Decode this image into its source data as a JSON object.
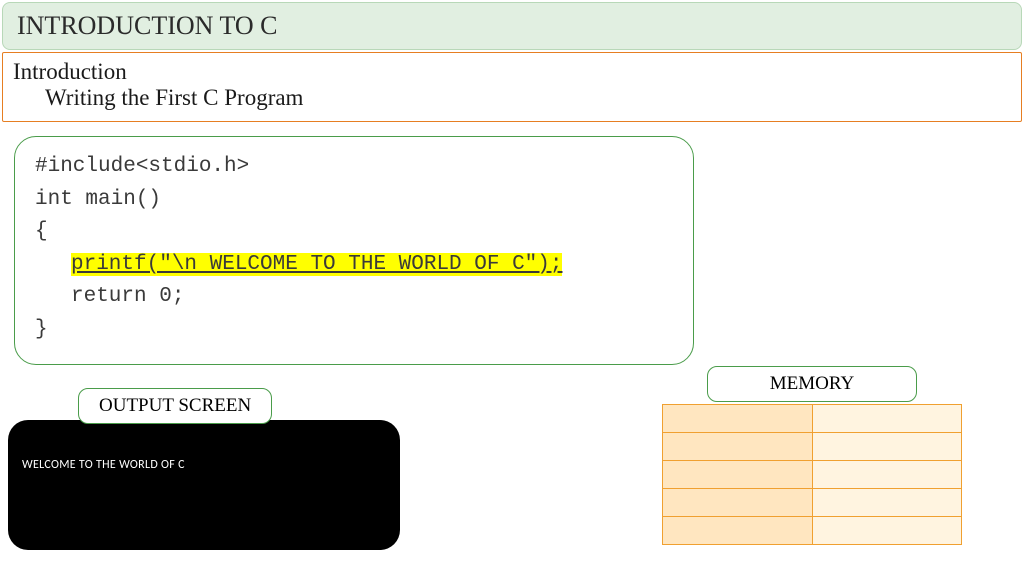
{
  "title": "INTRODUCTION TO C",
  "subtitle": {
    "main": "Introduction",
    "sub": "Writing the First C Program"
  },
  "code": {
    "line1": "#include<stdio.h>",
    "line2": "int main()",
    "line3": "{",
    "line4_hl": "printf(\"\\n WELCOME TO THE WORLD OF C\");",
    "line5": "return 0;",
    "line6": "}"
  },
  "output": {
    "label": "OUTPUT SCREEN",
    "text": "WELCOME TO THE WORLD OF C"
  },
  "memory": {
    "label": "MEMORY",
    "rows": 5
  }
}
